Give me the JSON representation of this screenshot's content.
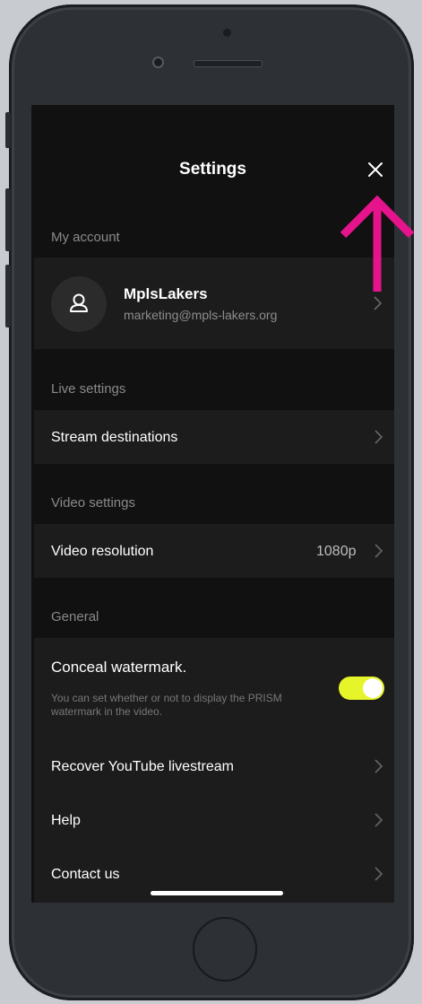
{
  "header": {
    "title": "Settings"
  },
  "account": {
    "section_label": "My account",
    "name": "MplsLakers",
    "email": "marketing@mpls-lakers.org"
  },
  "live": {
    "section_label": "Live settings",
    "stream_destinations": "Stream destinations"
  },
  "video": {
    "section_label": "Video settings",
    "resolution_label": "Video resolution",
    "resolution_value": "1080p"
  },
  "general": {
    "section_label": "General",
    "watermark_label": "Conceal watermark.",
    "watermark_description": "You can set whether or not to display the PRISM watermark in the video.",
    "watermark_enabled": true,
    "recover_youtube": "Recover YouTube livestream",
    "help": "Help",
    "contact": "Contact us"
  },
  "colors": {
    "accent_toggle": "#e6f529",
    "annotation_arrow": "#e6148c",
    "screen_bg": "#111111",
    "row_bg": "#1c1c1c"
  },
  "icons": [
    "close-icon",
    "user-icon",
    "chevron-right-icon",
    "annotation-arrow-icon"
  ]
}
